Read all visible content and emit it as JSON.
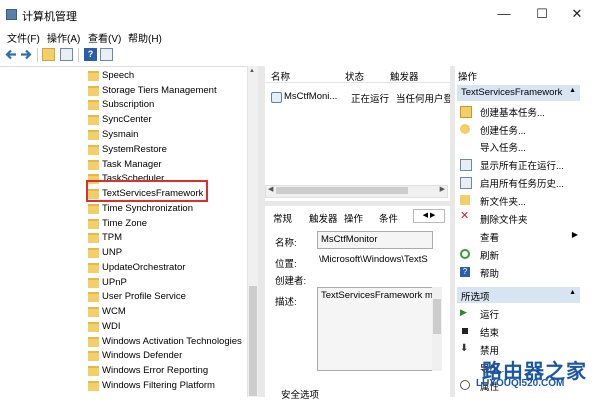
{
  "window": {
    "title": "计算机管理",
    "min": "—",
    "max": "☐",
    "close": "✕"
  },
  "menu": [
    "文件(F)",
    "操作(A)",
    "查看(V)",
    "帮助(H)"
  ],
  "tree": {
    "items": [
      "Speech",
      "Storage Tiers Management",
      "Subscription",
      "SyncCenter",
      "Sysmain",
      "SystemRestore",
      "Task Manager",
      "TaskScheduler",
      "TextServicesFramework",
      "Time Synchronization",
      "Time Zone",
      "TPM",
      "UNP",
      "UpdateOrchestrator",
      "UPnP",
      "User Profile Service",
      "WCM",
      "WDI",
      "Windows Activation Technologies",
      "Windows Defender",
      "Windows Error Reporting",
      "Windows Filtering Platform"
    ],
    "selected": "TextServicesFramework"
  },
  "task_list": {
    "headers": [
      "名称",
      "状态",
      "触发器"
    ],
    "row": {
      "name": "MsCtfMoni...",
      "status": "正在运行",
      "trigger": "当任何用户登录"
    }
  },
  "detail_tabs": [
    "常规",
    "触发器",
    "操作",
    "条件"
  ],
  "props": {
    "name_label": "名称:",
    "name_value": "MsCtfMonitor",
    "location_label": "位置:",
    "location_value": "\\Microsoft\\Windows\\TextS",
    "author_label": "创建者:",
    "desc_label": "描述:",
    "desc_value": "TextServicesFramework m",
    "security_label": "安全选项"
  },
  "actions": {
    "header": "操作",
    "section1": "TextServicesFramework",
    "items1": [
      "创建基本任务...",
      "创建任务...",
      "导入任务...",
      "显示所有正在运行...",
      "启用所有任务历史...",
      "新文件夹...",
      "删除文件夹",
      "查看",
      "刷新",
      "帮助"
    ],
    "section2": "所选项",
    "items2": [
      "运行",
      "结束",
      "禁用",
      "导出...",
      "属性"
    ]
  },
  "watermark": {
    "brand": "路由器之家",
    "url": "LUYOUQI520.COM"
  }
}
